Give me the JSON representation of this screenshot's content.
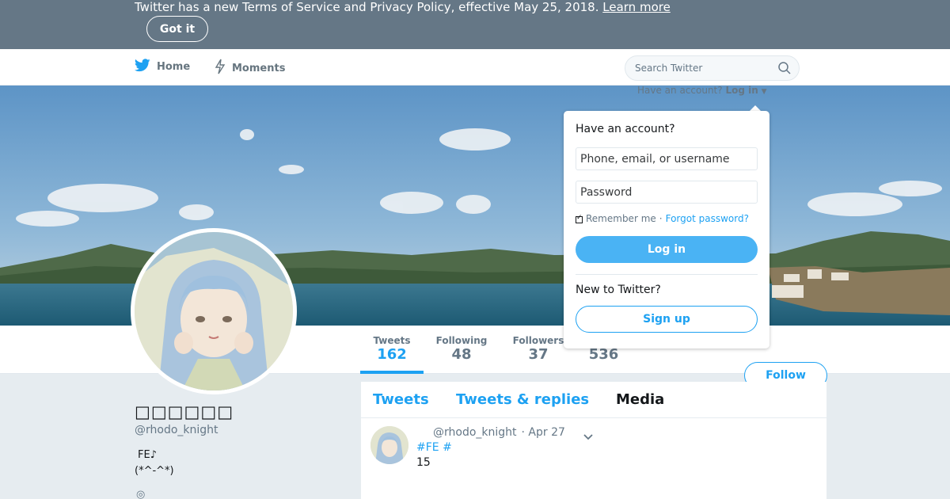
{
  "notice": {
    "text": "Twitter has a new Terms of Service and Privacy Policy, effective May 25, 2018.",
    "link_label": "Learn more",
    "got_it_label": "Got it"
  },
  "nav": {
    "home_label": "Home",
    "home_icon": "twitter-bird-icon",
    "moments_label": "Moments",
    "moments_icon": "lightning-icon",
    "search_placeholder": "Search Twitter",
    "search_icon": "search-icon"
  },
  "account_bar": {
    "prompt": "Have an account?",
    "login_label": "Log in"
  },
  "login_dropdown": {
    "title": "Have an account?",
    "username_placeholder": "Phone, email, or username",
    "password_placeholder": "Password",
    "remember_label": "Remember me",
    "separator": "·",
    "forgot_label": "Forgot password?",
    "login_button": "Log in",
    "new_prompt": "New to Twitter?",
    "signup_button": "Sign up"
  },
  "stats": [
    {
      "label": "Tweets",
      "value": "162"
    },
    {
      "label": "Following",
      "value": "48"
    },
    {
      "label": "Followers",
      "value": "37"
    },
    {
      "label": "",
      "value": "536"
    }
  ],
  "follow_label": "Follow",
  "profile": {
    "name": "□□□□□□",
    "handle": "@rhodo_knight",
    "bio_line1": "FE♪",
    "bio_line2": "(*^-^*)",
    "bio_line3": "◎"
  },
  "timeline": {
    "tabs": [
      "Tweets",
      "Tweets & replies",
      "Media"
    ],
    "active_tab": "Media"
  },
  "tweet": {
    "handle": "@rhodo_knight",
    "date": "· Apr 27",
    "tags": "#FE #",
    "text": "15"
  },
  "colors": {
    "accent": "#1da1f2",
    "notice_bg": "#657786",
    "page_bg": "#e6ecf0"
  }
}
